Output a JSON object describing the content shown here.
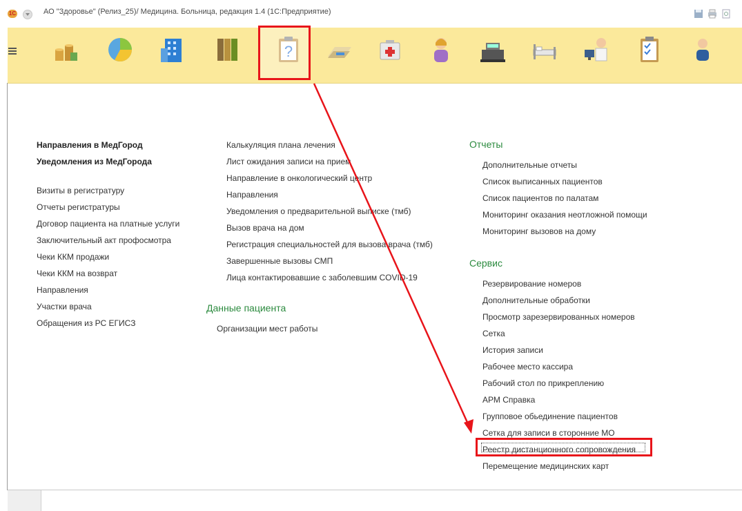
{
  "window": {
    "title": "АО \"Здоровье\" (Релиз_25)/ Медицина. Больница, редакция 1.4  (1С:Предприятие)",
    "logo": "1С"
  },
  "sections_panel": {
    "icons": [
      "menu-icon",
      "money-icon",
      "pie-chart-icon",
      "building-icon",
      "folders-icon",
      "question-clipboard-icon",
      "doctor-folder-icon",
      "first-aid-icon",
      "patient-icon",
      "user-icon",
      "cash-register-icon",
      "hospital-bed-icon",
      "doctor-pc-icon",
      "checklist-icon",
      "person-icon"
    ],
    "active": "question-clipboard-icon"
  },
  "col1": {
    "bold_items": [
      "Направления в МедГород",
      "Уведомления из МедГорода"
    ],
    "items": [
      "Визиты в регистратуру",
      "Отчеты регистратуры",
      "Договор пациента на платные услуги",
      "Заключительный акт профосмотра",
      "Чеки ККМ продажи",
      "Чеки ККМ на возврат",
      "Направления",
      "Участки врача",
      "Обращения из РС ЕГИСЗ"
    ]
  },
  "col2": {
    "items": [
      "Калькуляция плана лечения",
      "Лист ожидания записи на прием",
      "Направление в онкологический центр",
      "Направления",
      "Уведомления о предварительной выписке (тмб)",
      "Вызов врача на дом",
      "Регистрация специальностей для вызова врача (тмб)",
      "Завершенные вызовы СМП",
      "Лица контактировавшие с заболевшим COVID-19"
    ],
    "group_title": "Данные пациента",
    "group_items": [
      "Организации мест работы"
    ]
  },
  "col3": {
    "reports_title": "Отчеты",
    "reports": [
      "Дополнительные отчеты",
      "Список выписанных пациентов",
      "Список пациентов по палатам",
      "Мониторинг оказания неотложной помощи",
      "Мониторинг вызовов на дому"
    ],
    "service_title": "Сервис",
    "service": [
      "Резервирование номеров",
      "Дополнительные обработки",
      "Просмотр зарезервированных номеров",
      "Сетка",
      "История записи",
      "Рабочее место кассира",
      "Рабочий стол по прикреплению",
      "АРМ Справка",
      "Групповое обьединение пациентов",
      "Сетка для записи в сторонние МО",
      "Реестр дистанционного сопровождения",
      "Перемещение медицинских карт"
    ],
    "highlighted": "Реестр дистанционного сопровождения"
  },
  "colors": {
    "section_bar": "#fbe99b",
    "group_title": "#2b8a3e",
    "annotation": "#e8141a"
  }
}
